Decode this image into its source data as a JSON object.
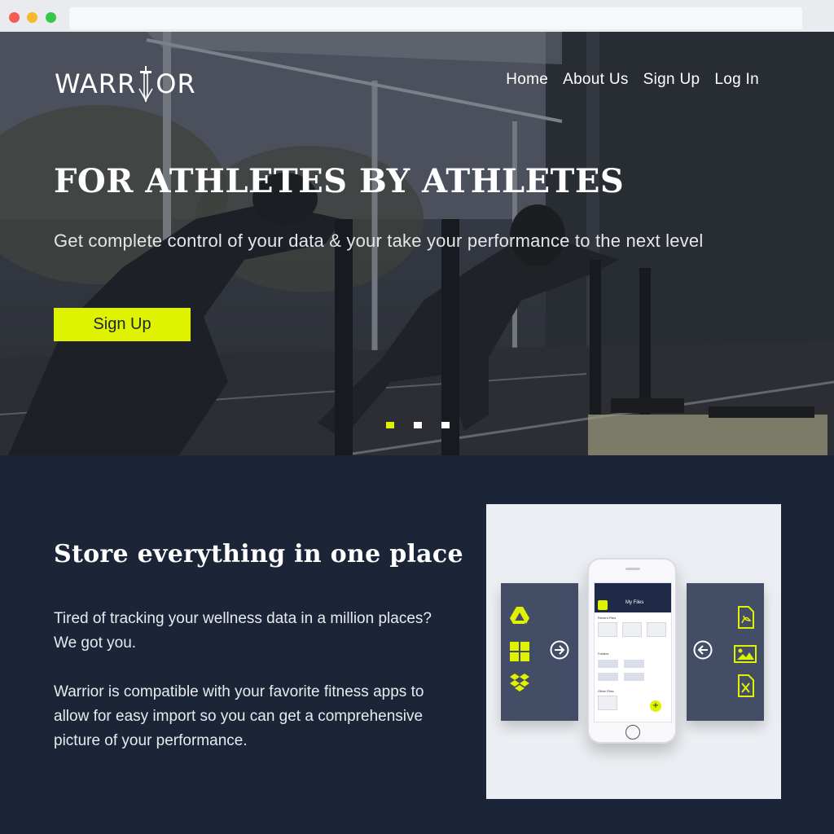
{
  "brand": {
    "logo_left": "WARR",
    "logo_right": "OR",
    "accent_color": "#dff200",
    "navy_color": "#1c2438"
  },
  "nav": {
    "items": [
      "Home",
      "About Us",
      "Sign Up",
      "Log In"
    ]
  },
  "hero": {
    "title": "FOR ATHLETES BY ATHLETES",
    "subtitle": "Get complete control of your data & your take your performance to the next level",
    "cta_label": "Sign Up",
    "carousel": {
      "count": 3,
      "active_index": 0
    }
  },
  "feature": {
    "title": "Store everything in one place",
    "paragraph1": "Tired of tracking your wellness data  in a million places?  We got you.",
    "paragraph2": "Warrior is compatible with your favorite fitness apps  to allow for easy import so you can get a comprehensive picture of your performance.",
    "illustration": {
      "left_icons": [
        "google-drive-icon",
        "windows-icon",
        "dropbox-icon"
      ],
      "left_arrow": "arrow-right-circle-icon",
      "right_icons": [
        "pdf-file-icon",
        "image-file-icon",
        "excel-file-icon"
      ],
      "right_arrow": "arrow-left-circle-icon",
      "phone_screen": {
        "header_title": "My Files",
        "recent_label": "Recent Files",
        "folders_label": "Folders",
        "other_label": "Other Files"
      }
    }
  }
}
